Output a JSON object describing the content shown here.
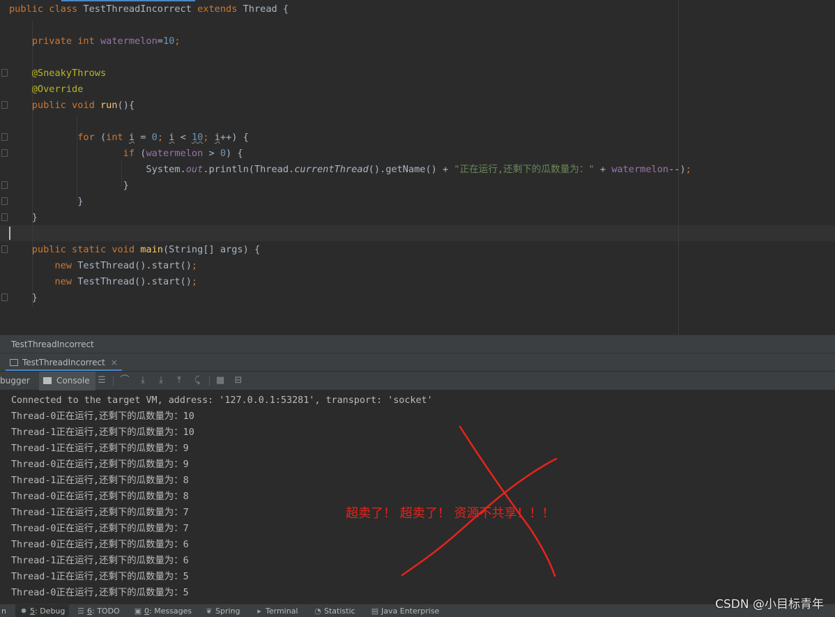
{
  "editor": {
    "lines": [
      [
        {
          "t": "public class ",
          "c": "kw"
        },
        {
          "t": "TestThreadIncorrect ",
          "c": ""
        },
        {
          "t": "extends ",
          "c": "kw"
        },
        {
          "t": "Thread {",
          "c": ""
        }
      ],
      [],
      [
        {
          "t": "    private int ",
          "c": "kw"
        },
        {
          "t": "watermelon",
          "c": "fld"
        },
        {
          "t": "=",
          "c": ""
        },
        {
          "t": "10",
          "c": "num"
        },
        {
          "t": ";",
          "c": "kw"
        }
      ],
      [],
      [
        {
          "t": "    @SneakyThrows",
          "c": "ann"
        }
      ],
      [
        {
          "t": "    @Override",
          "c": "ann"
        }
      ],
      [
        {
          "t": "    public void ",
          "c": "kw"
        },
        {
          "t": "run",
          "c": "fn"
        },
        {
          "t": "(){",
          "c": ""
        }
      ],
      [],
      [
        {
          "t": "            for ",
          "c": "kw"
        },
        {
          "t": "(",
          "c": ""
        },
        {
          "t": "int ",
          "c": "kw"
        },
        {
          "t": "i",
          "c": "squig"
        },
        {
          "t": " = ",
          "c": ""
        },
        {
          "t": "0",
          "c": "num"
        },
        {
          "t": "; ",
          "c": "kw"
        },
        {
          "t": "i",
          "c": "squig"
        },
        {
          "t": " < ",
          "c": ""
        },
        {
          "t": "10",
          "c": "num squig"
        },
        {
          "t": "; ",
          "c": "kw"
        },
        {
          "t": "i",
          "c": "squig"
        },
        {
          "t": "++) {",
          "c": ""
        }
      ],
      [
        {
          "t": "                    if ",
          "c": "kw"
        },
        {
          "t": "(",
          "c": ""
        },
        {
          "t": "watermelon",
          "c": "fld"
        },
        {
          "t": " > ",
          "c": ""
        },
        {
          "t": "0",
          "c": "num"
        },
        {
          "t": ") {",
          "c": ""
        }
      ],
      [
        {
          "t": "                        System.",
          "c": ""
        },
        {
          "t": "out",
          "c": "fldit"
        },
        {
          "t": ".println(Thread.",
          "c": ""
        },
        {
          "t": "currentThread",
          "c": "it"
        },
        {
          "t": "().getName() + ",
          "c": ""
        },
        {
          "t": "\"正在运行,还剩下的瓜数量为：\"",
          "c": "str"
        },
        {
          "t": " + ",
          "c": ""
        },
        {
          "t": "watermelon",
          "c": "fld"
        },
        {
          "t": "--)",
          "c": ""
        },
        {
          "t": ";",
          "c": "kw"
        }
      ],
      [
        {
          "t": "                    }",
          "c": ""
        }
      ],
      [
        {
          "t": "            }",
          "c": ""
        }
      ],
      [
        {
          "t": "    }",
          "c": ""
        }
      ],
      [],
      [
        {
          "t": "    public static void ",
          "c": "kw"
        },
        {
          "t": "main",
          "c": "fn"
        },
        {
          "t": "(String[] args) {",
          "c": ""
        }
      ],
      [
        {
          "t": "        new ",
          "c": "kw"
        },
        {
          "t": "TestThread().start()",
          "c": ""
        },
        {
          "t": ";",
          "c": "kw"
        }
      ],
      [
        {
          "t": "        new ",
          "c": "kw"
        },
        {
          "t": "TestThread().start()",
          "c": ""
        },
        {
          "t": ";",
          "c": "kw"
        }
      ],
      [
        {
          "t": "    }",
          "c": ""
        }
      ]
    ]
  },
  "breadcrumb": {
    "item": "TestThreadIncorrect"
  },
  "run_tab": {
    "label": "TestThreadIncorrect",
    "close": "×"
  },
  "debug_toolbar": {
    "debugger_label": "bugger",
    "console_label": "Console"
  },
  "console": {
    "lines": [
      "Connected to the target VM, address: '127.0.0.1:53281', transport: 'socket'",
      "Thread-0正在运行,还剩下的瓜数量为：10",
      "Thread-1正在运行,还剩下的瓜数量为：10",
      "Thread-1正在运行,还剩下的瓜数量为：9",
      "Thread-0正在运行,还剩下的瓜数量为：9",
      "Thread-1正在运行,还剩下的瓜数量为：8",
      "Thread-0正在运行,还剩下的瓜数量为：8",
      "Thread-1正在运行,还剩下的瓜数量为：7",
      "Thread-0正在运行,还剩下的瓜数量为：7",
      "Thread-0正在运行,还剩下的瓜数量为：6",
      "Thread-1正在运行,还剩下的瓜数量为：6",
      "Thread-1正在运行,还剩下的瓜数量为：5",
      "Thread-0正在运行,还剩下的瓜数量为：5"
    ],
    "annotation": "超卖了！ 超卖了！ 资源不共享！！！",
    "annotation_color": "#e8231c"
  },
  "status_bar": {
    "items": [
      {
        "num": "",
        "label": "n"
      },
      {
        "num": "5",
        "label": ": Debug"
      },
      {
        "num": "6",
        "label": ": TODO"
      },
      {
        "num": "0",
        "label": ": Messages"
      },
      {
        "num": "",
        "label": "Spring"
      },
      {
        "num": "",
        "label": "Terminal"
      },
      {
        "num": "",
        "label": "Statistic"
      },
      {
        "num": "",
        "label": "Java Enterprise"
      }
    ]
  },
  "watermark": "CSDN @小目标青年",
  "colors": {
    "keyword": "#cc7832",
    "annotation": "#bbb529",
    "field": "#9876aa",
    "number": "#6897bb",
    "string": "#6a8759",
    "method": "#ffc66d",
    "background": "#2b2b2b"
  }
}
